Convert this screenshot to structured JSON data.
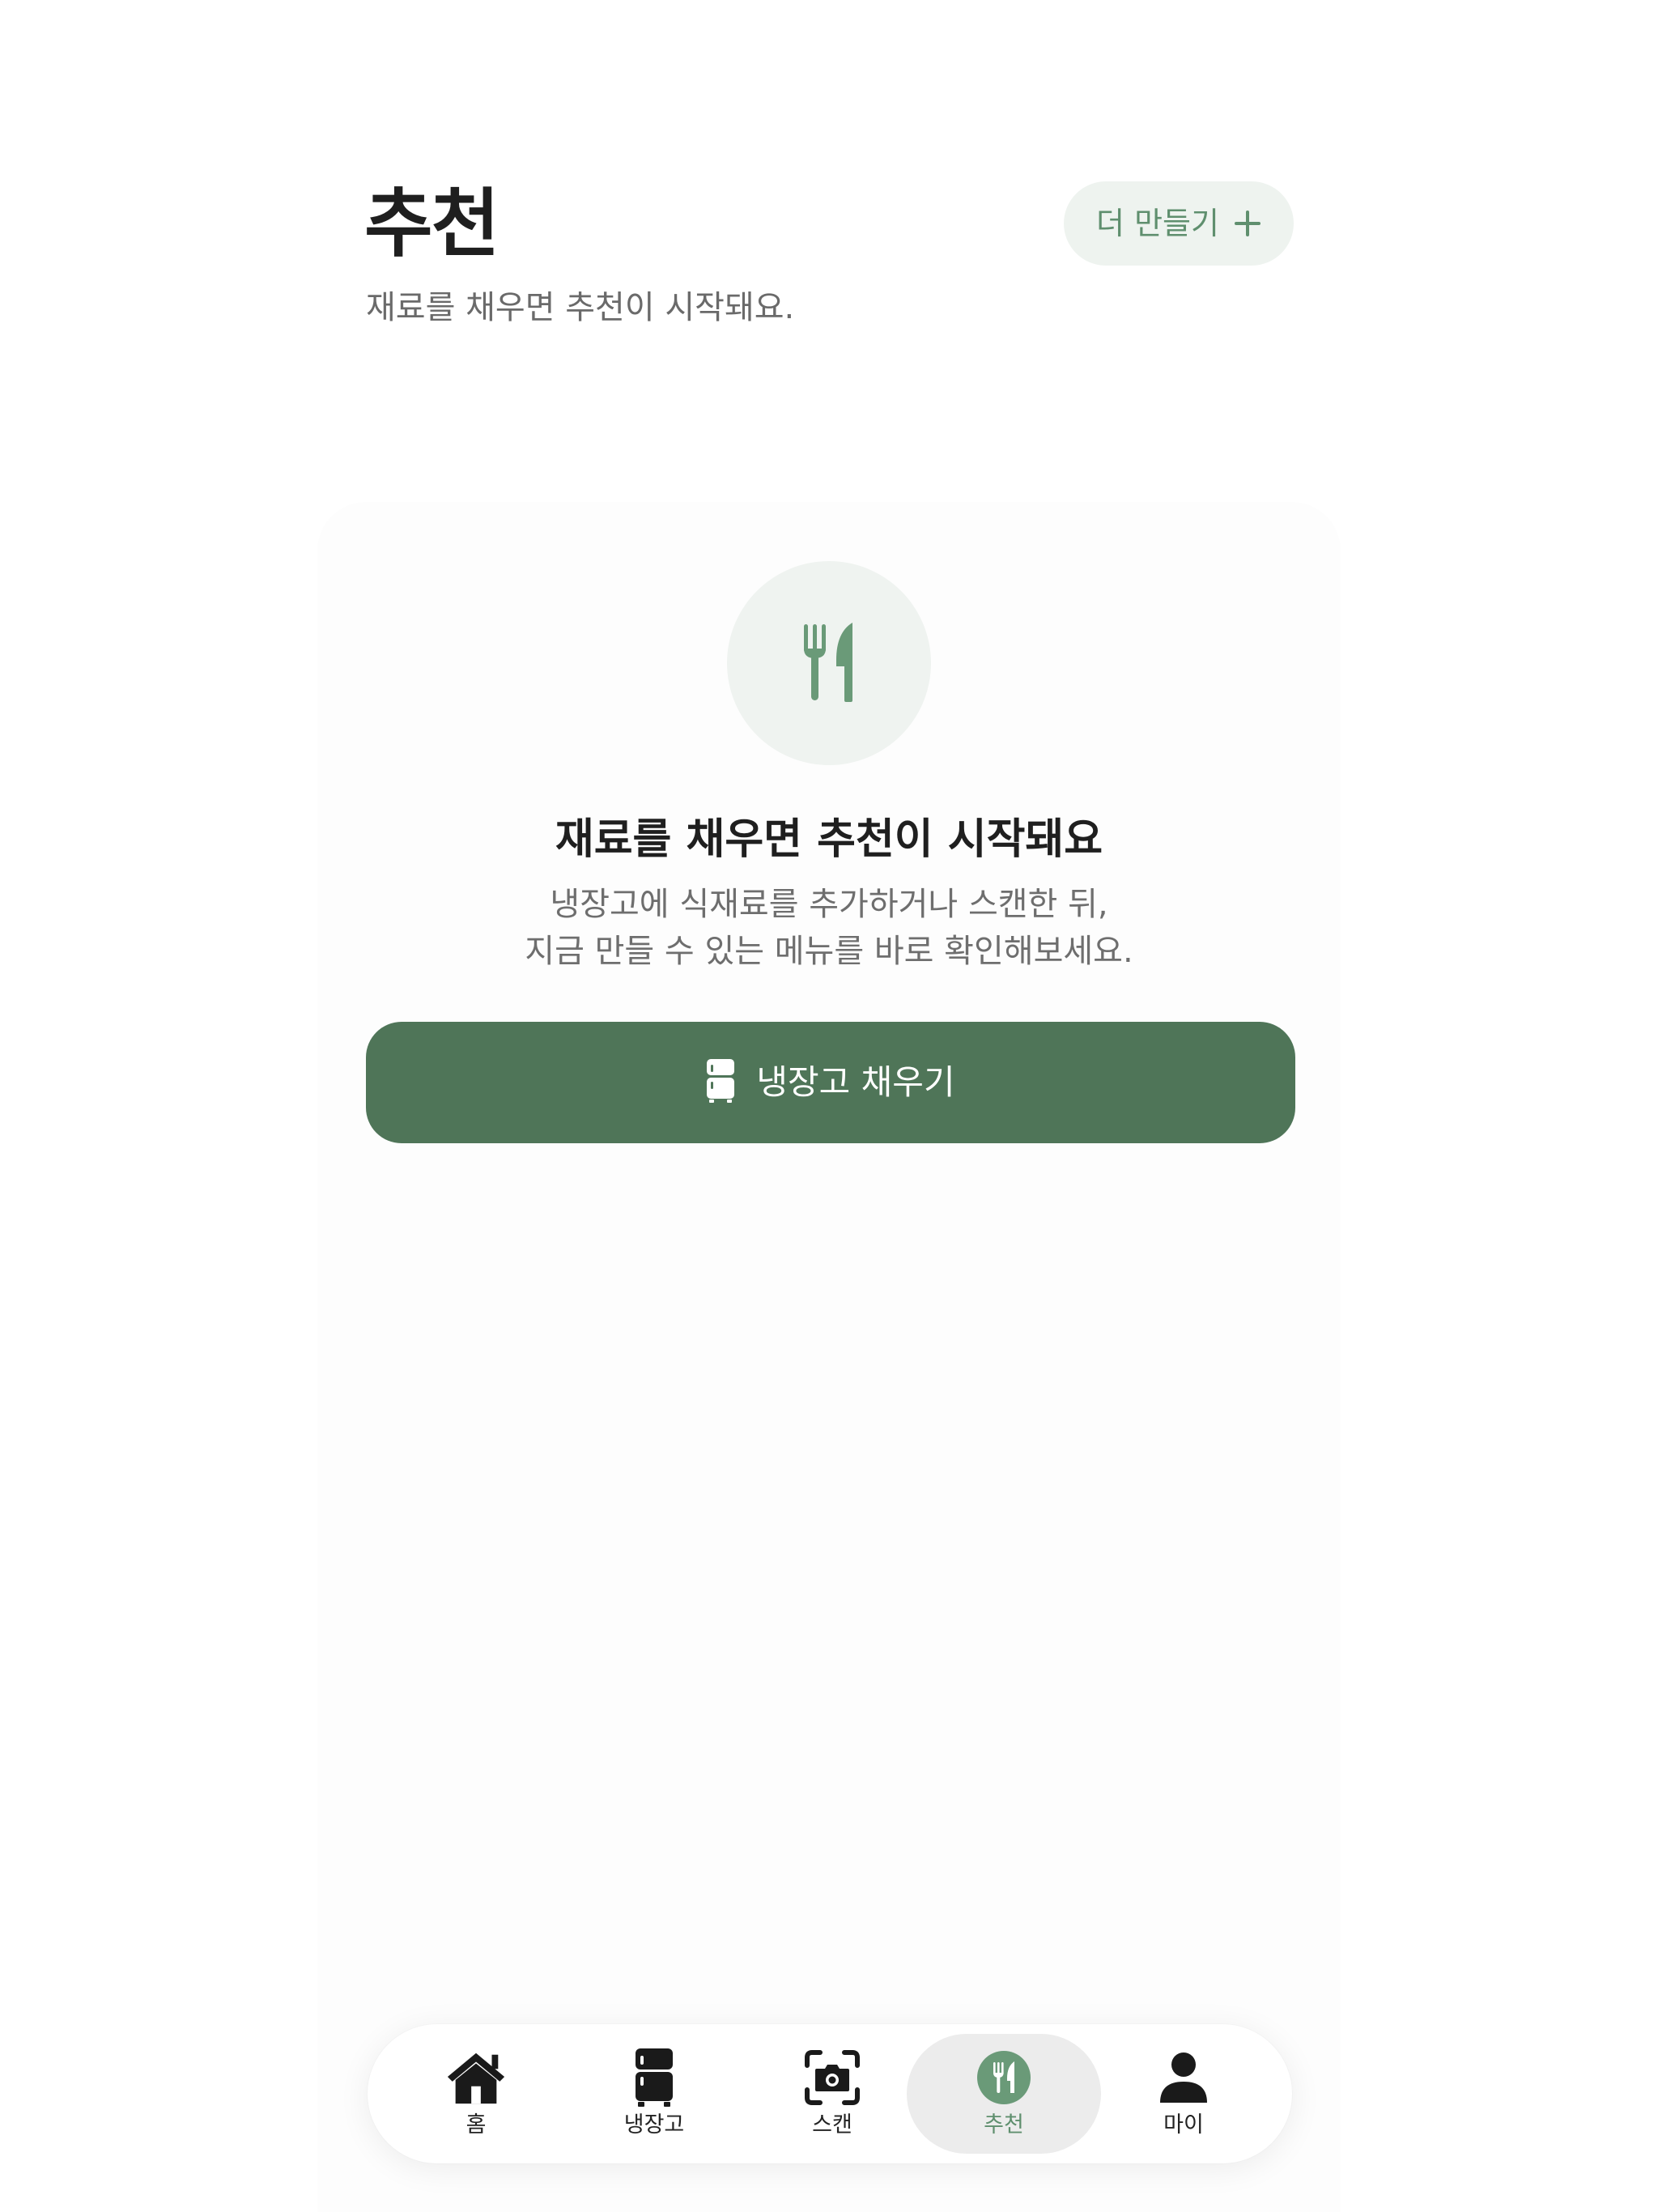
{
  "header": {
    "title": "추천",
    "subtitle": "재료를 채우면 추천이 시작돼요.",
    "more_button_label": "더 만들기"
  },
  "empty_state": {
    "icon": "fork-knife-icon",
    "title": "재료를 채우면 추천이 시작돼요",
    "description_line1": "냉장고에 식재료를 추가하거나 스캔한 뒤,",
    "description_line2": "지금 만들 수 있는 메뉴를 바로 확인해보세요.",
    "button_label": "냉장고 채우기",
    "button_icon": "refrigerator-icon"
  },
  "tab_bar": {
    "items": [
      {
        "label": "홈",
        "icon": "home-icon",
        "active": false
      },
      {
        "label": "냉장고",
        "icon": "refrigerator-icon",
        "active": false
      },
      {
        "label": "스캔",
        "icon": "camera-scan-icon",
        "active": false
      },
      {
        "label": "추천",
        "icon": "fork-knife-icon",
        "active": true
      },
      {
        "label": "마이",
        "icon": "person-icon",
        "active": false
      }
    ]
  },
  "colors": {
    "accent": "#4f7558",
    "accent_light": "#5f8f6e",
    "accent_bg": "#eef3ef",
    "text_primary": "#1f1f1f",
    "text_secondary": "#6a6a6a"
  }
}
